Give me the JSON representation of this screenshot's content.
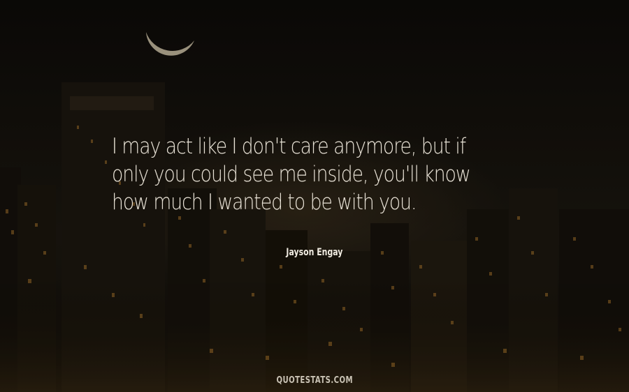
{
  "quote": {
    "lines": [
      "I may act like I don't care anymore, but if",
      "only you could see me inside, you'll know",
      "how much I wanted to be with you."
    ],
    "author": "Jayson Engay"
  },
  "footer": {
    "site": "QUOTESTATS.COM"
  },
  "colors": {
    "text": "#e8e2d6",
    "sky": "#0d0b08",
    "window_light": "#c8913a",
    "moon": "#e6dcc0"
  }
}
